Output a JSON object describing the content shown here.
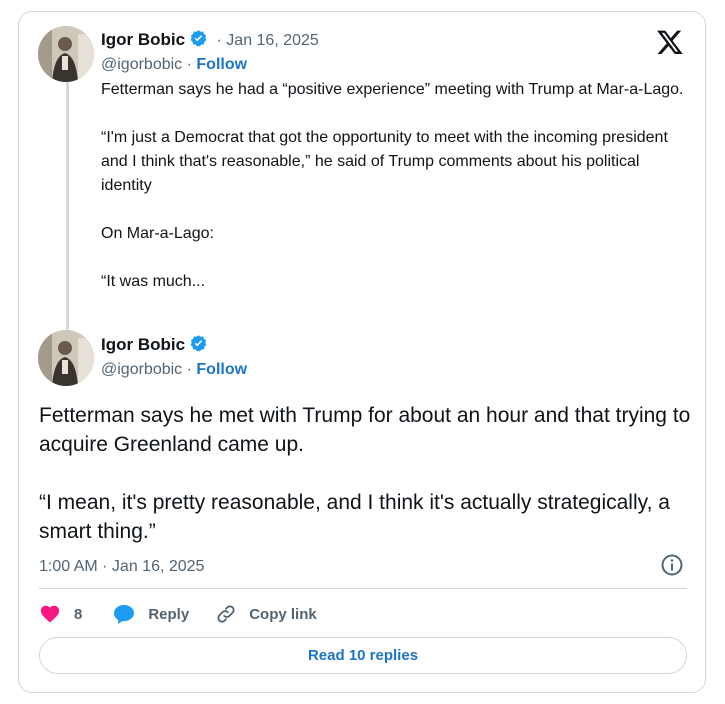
{
  "colors": {
    "accent": "#1d74c9",
    "like": "#f91880",
    "muted": "#536471",
    "border": "#cfd9de"
  },
  "quoted_post": {
    "author_name": "Igor Bobic",
    "date": "· Jan 16, 2025",
    "handle": "@igorbobic",
    "separator": "·",
    "follow_label": "Follow",
    "paragraphs": [
      "Fetterman says he had a “positive experience” meeting with Trump at Mar-a-Lago.",
      "“I'm just a Democrat that got the opportunity to meet with the incoming president and I think that's reasonable,” he said of Trump comments about his political identity",
      "On Mar-a-Lago:",
      "“It was much..."
    ]
  },
  "main_post": {
    "author_name": "Igor Bobic",
    "handle": "@igorbobic",
    "separator": "·",
    "follow_label": "Follow",
    "paragraphs": [
      "Fetterman says he met with Trump for about an hour and that trying to acquire Greenland came up.",
      "“I mean, it's pretty reasonable, and I think it's actually strategically, a smart thing.”"
    ],
    "timestamp": "1:00 AM · Jan 16, 2025"
  },
  "actions": {
    "like_count": "8",
    "reply_label": "Reply",
    "copy_link_label": "Copy link"
  },
  "read_replies_label": "Read 10 replies",
  "icons": [
    "x-logo-icon",
    "verified-badge-icon",
    "info-icon",
    "heart-icon",
    "reply-bubble-icon",
    "link-icon"
  ]
}
